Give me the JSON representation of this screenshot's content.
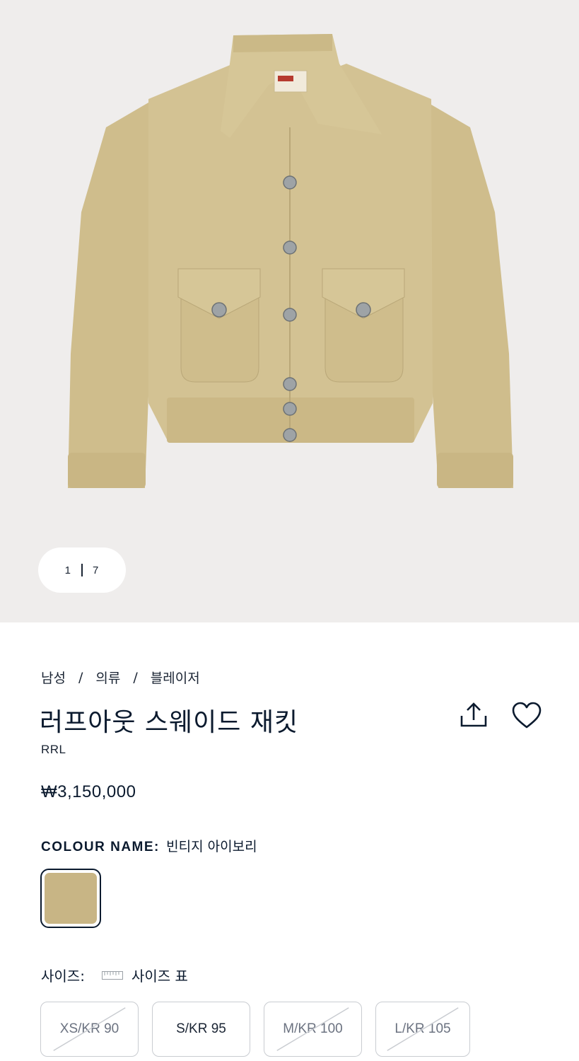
{
  "gallery": {
    "current": "1",
    "total": "7",
    "label_brand": "RRL"
  },
  "breadcrumb": [
    "남성",
    "의류",
    "블레이저"
  ],
  "product": {
    "title": "러프아웃 스웨이드 재킷",
    "brand": "RRL",
    "price": "₩3,150,000"
  },
  "colour": {
    "label": "COLOUR NAME:",
    "value": "빈티지 아이보리",
    "swatch_color": "#c8b585"
  },
  "size": {
    "label": "사이즈:",
    "guide_label": "사이즈 표",
    "options": [
      {
        "label": "XS/KR 90",
        "available": false
      },
      {
        "label": "S/KR 95",
        "available": true
      },
      {
        "label": "M/KR 100",
        "available": false
      },
      {
        "label": "L/KR 105",
        "available": false
      }
    ]
  },
  "icons": {
    "share": "share-icon",
    "favorite": "heart-icon",
    "size_guide": "ruler-icon"
  }
}
